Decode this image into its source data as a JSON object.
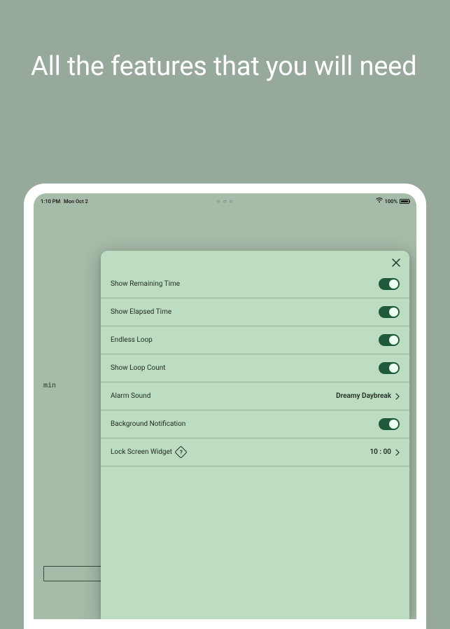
{
  "headline": "All the features that you will need",
  "status_bar": {
    "time": "1:10 PM",
    "date": "Mon Oct 2",
    "center": "○ ○ ○",
    "battery_pct": "100%"
  },
  "background_text": "min",
  "panel": {
    "rows": [
      {
        "label": "Show Remaining Time",
        "type": "toggle",
        "on": true
      },
      {
        "label": "Show Elapsed Time",
        "type": "toggle",
        "on": true
      },
      {
        "label": "Endless Loop",
        "type": "toggle",
        "on": true
      },
      {
        "label": "Show Loop Count",
        "type": "toggle",
        "on": true
      },
      {
        "label": "Alarm Sound",
        "type": "nav",
        "value": "Dreamy Daybreak"
      },
      {
        "label": "Background Notification",
        "type": "toggle",
        "on": true
      },
      {
        "label": "Lock Screen Widget",
        "type": "nav",
        "value": "10 : 00",
        "help": true
      }
    ]
  }
}
